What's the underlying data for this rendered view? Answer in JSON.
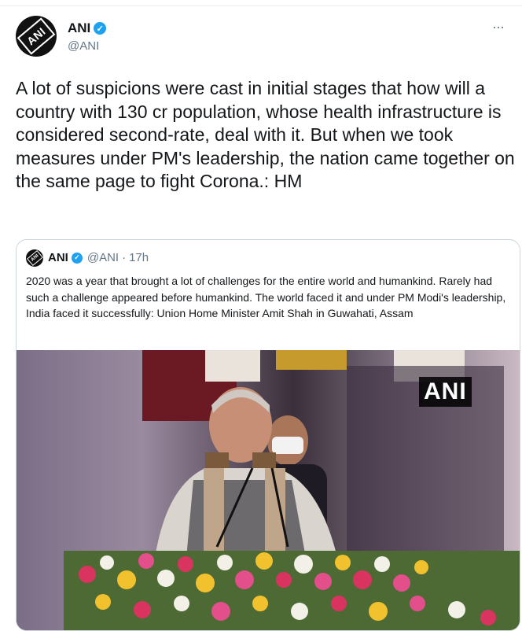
{
  "tweet": {
    "author_name": "ANI",
    "author_handle": "@ANI",
    "avatar_text": "ANI",
    "more_icon": "more-dots-icon",
    "text": "A lot of suspicions were cast in initial stages that how will a country with 130 cr population, whose health infrastructure is considered second-rate, deal with it. But when we took measures under PM's leadership, the nation came together on the same page to fight Corona.: HM"
  },
  "quoted_tweet": {
    "author_name": "ANI",
    "author_handle": "@ANI",
    "separator": "·",
    "time": "17h",
    "text": "2020 was a year that brought a lot of challenges for the entire world and humankind. Rarely had such a challenge appeared before humankind. The world faced it and under PM Modi's leadership, India faced it successfully:  Union Home Minister Amit Shah in Guwahati, Assam",
    "media_watermark": "ANI"
  },
  "colors": {
    "accent": "#1da1f2",
    "text": "#14171a",
    "secondary_text": "#657786",
    "border": "#ccd6dd"
  }
}
